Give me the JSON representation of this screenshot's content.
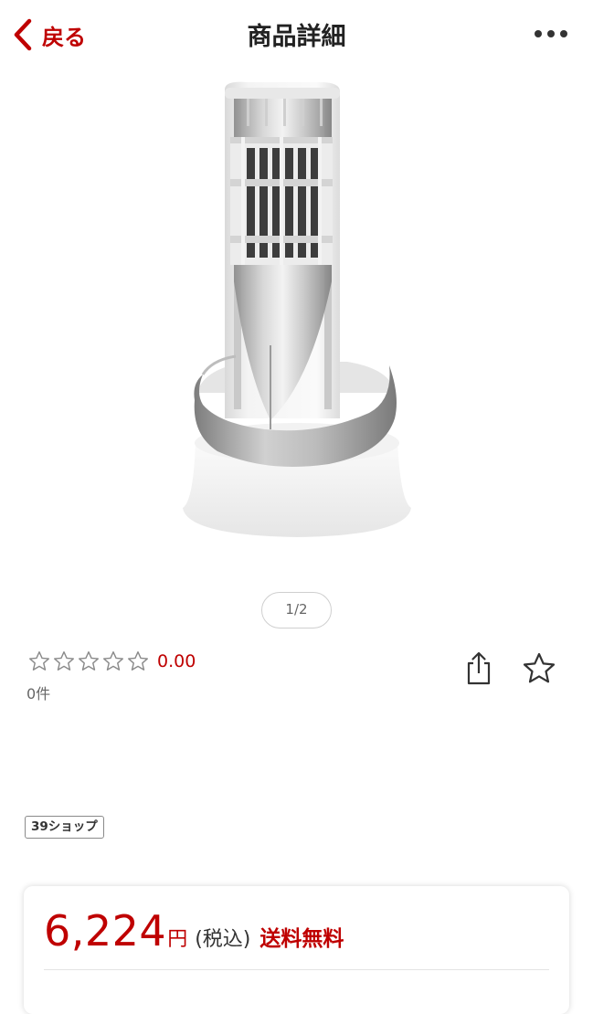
{
  "header": {
    "back_label": "戻る",
    "title": "商品詳細",
    "more_icon": "more-horizontal-icon"
  },
  "gallery": {
    "pager": "1/2",
    "current": 1,
    "total": 2
  },
  "rating": {
    "stars_filled": 0,
    "stars_total": 5,
    "value": "0.00",
    "count_text": "0件"
  },
  "actions": {
    "share_icon": "share-icon",
    "favorite_icon": "star-outline-icon"
  },
  "shop": {
    "tag": "39ショップ"
  },
  "price": {
    "amount": "6,224",
    "currency": "円",
    "tax": "(税込)",
    "shipping": "送料無料"
  },
  "colors": {
    "accent": "#bf0000",
    "text": "#222222",
    "muted": "#666666"
  }
}
